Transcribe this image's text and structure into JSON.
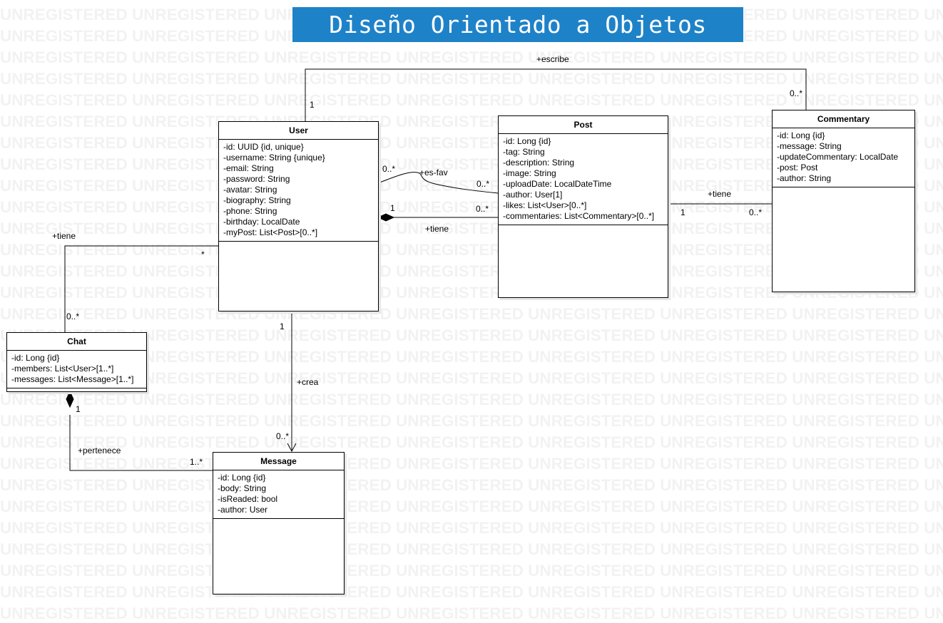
{
  "watermark_text": "UNREGISTERED",
  "title": "Diseño Orientado a Objetos",
  "colors": {
    "title_bg": "#1e82c8",
    "title_text": "#ffffff",
    "watermark": "#f2f2f2",
    "line": "#000000"
  },
  "classes": {
    "user": {
      "name": "User",
      "attributes": [
        "-id: UUID {id, unique}",
        "-username: String {unique}",
        "-email: String",
        "-password: String",
        "-avatar: String",
        "-biography: String",
        "-phone: String",
        "-birthday: LocalDate",
        "-myPost: List<Post>[0..*]"
      ]
    },
    "post": {
      "name": "Post",
      "attributes": [
        "-id: Long {id}",
        "-tag: String",
        "-description: String",
        "-image: String",
        "-uploadDate: LocalDateTime",
        "-author: User[1]",
        "-likes: List<User>[0..*]",
        "-commentaries: List<Commentary>[0..*]"
      ]
    },
    "commentary": {
      "name": "Commentary",
      "attributes": [
        "-id: Long {id}",
        "-message: String",
        "-updateCommentary: LocalDate",
        "-post: Post",
        "-author: String"
      ]
    },
    "chat": {
      "name": "Chat",
      "attributes": [
        "-id: Long {id}",
        "-members: List<User>[1..*]",
        "-messages: List<Message>[1..*]"
      ]
    },
    "message": {
      "name": "Message",
      "attributes": [
        "-id: Long {id}",
        "-body: String",
        "-isReaded: bool",
        "-author: User"
      ]
    }
  },
  "associations": {
    "escribe": {
      "label": "+escribe",
      "from_mult": "1",
      "to_mult": "0..*"
    },
    "es_fav": {
      "label": "+es-fav",
      "from_mult": "0..*",
      "to_mult": "0..*"
    },
    "user_post": {
      "label": "+tiene",
      "from_mult": "1",
      "to_mult": "0..*"
    },
    "post_commentary": {
      "label": "+tiene",
      "from_mult": "1",
      "to_mult": "0..*"
    },
    "user_chat": {
      "label": "+tiene",
      "from_mult": "*",
      "to_mult": "0..*"
    },
    "crea": {
      "label": "+crea",
      "from_mult": "1",
      "to_mult": "0..*"
    },
    "pertenece": {
      "label": "+pertenece",
      "from_mult": "1",
      "to_mult": "1..*"
    }
  }
}
